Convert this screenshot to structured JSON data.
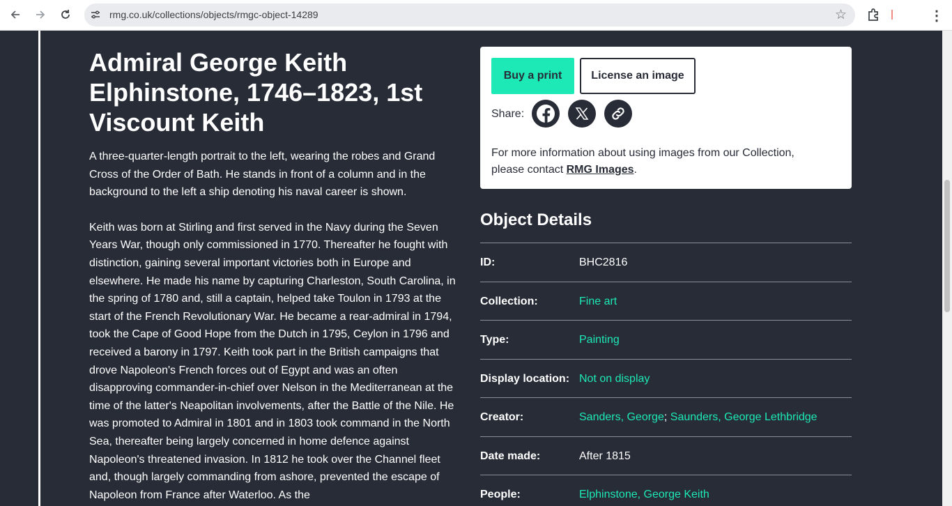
{
  "browser": {
    "url": "rmg.co.uk/collections/objects/rmgc-object-14289"
  },
  "object": {
    "title": "Admiral George Keith Elphinstone, 1746–1823, 1st Viscount Keith",
    "description": [
      "A three-quarter-length portrait to the left, wearing the robes and Grand Cross of the Order of Bath. He stands in front of a column and in the background to the left a ship denoting his naval career is shown.",
      "Keith was born at Stirling and first served in the Navy during the Seven Years War, though only commissioned in 1770. Thereafter he fought with distinction, gaining several important victories both in Europe and elsewhere. He made his name by capturing Charleston, South Carolina, in the spring of 1780 and, still a captain, helped take Toulon in 1793 at the start of the French Revolutionary War. He became a rear-admiral in 1794, took the Cape of Good Hope from the Dutch in 1795, Ceylon in 1796 and received a barony in 1797. Keith took part in the British campaigns that drove Napoleon's French forces out of Egypt and was an often disapproving commander-in-chief over Nelson in the Mediterranean at the time of the latter's Neapolitan involvements, after the Battle of the Nile. He was promoted to Admiral in 1801 and in 1803 took command in the North Sea, thereafter being largely concerned in home defence against Napoleon's threatened invasion. In 1812 he took over the Channel fleet and, though largely commanding from ashore, prevented the escape of Napoleon from France after Waterloo. As the"
    ]
  },
  "card": {
    "buy_label": "Buy a print",
    "license_label": "License an image",
    "share_label": "Share:",
    "share_icons": [
      "facebook-icon",
      "x-icon",
      "link-icon"
    ],
    "info_prefix": "For more information about using images from our Collection, please contact ",
    "info_link": "RMG Images",
    "info_suffix": "."
  },
  "details": {
    "title": "Object Details",
    "id_label": "ID:",
    "id_value": "BHC2816",
    "collection_label": "Collection:",
    "collection_value": "Fine art",
    "type_label": "Type:",
    "type_value": "Painting",
    "display_label": "Display location:",
    "display_value": "Not on display",
    "creator_label": "Creator:",
    "creator_1": "Sanders, George",
    "creator_sep": ";",
    "creator_2": "Saunders, George Lethbridge",
    "date_label": "Date made:",
    "date_value": "After 1815",
    "people_label": "People:",
    "people_value": "Elphinstone, George Keith"
  },
  "colors": {
    "page_bg": "#272c37",
    "accent": "#1de9b6"
  }
}
